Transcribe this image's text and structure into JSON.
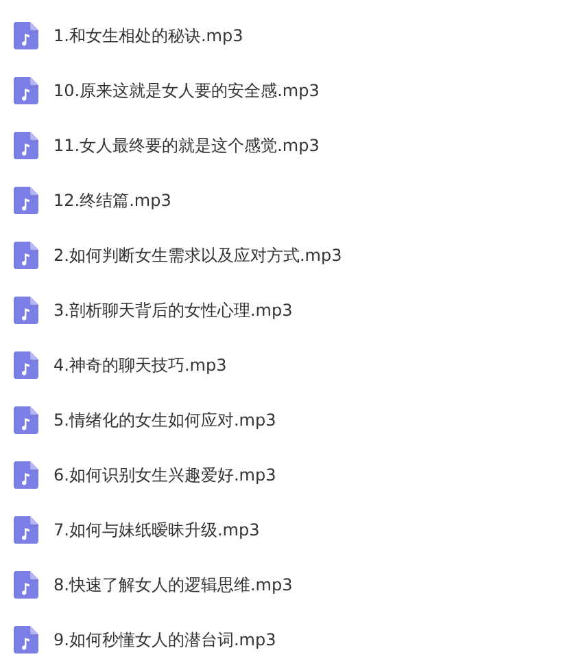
{
  "files": [
    {
      "name": "1.和女生相处的秘诀.mp3"
    },
    {
      "name": "10.原来这就是女人要的安全感.mp3"
    },
    {
      "name": "11.女人最终要的就是这个感觉.mp3"
    },
    {
      "name": "12.终结篇.mp3"
    },
    {
      "name": "2.如何判断女生需求以及应对方式.mp3"
    },
    {
      "name": "3.剖析聊天背后的女性心理.mp3"
    },
    {
      "name": "4.神奇的聊天技巧.mp3"
    },
    {
      "name": "5.情绪化的女生如何应对.mp3"
    },
    {
      "name": "6.如何识别女生兴趣爱好.mp3"
    },
    {
      "name": "7.如何与妹纸暧昧升级.mp3"
    },
    {
      "name": "8.快速了解女人的逻辑思维.mp3"
    },
    {
      "name": "9.如何秒懂女人的潜台词.mp3"
    }
  ]
}
